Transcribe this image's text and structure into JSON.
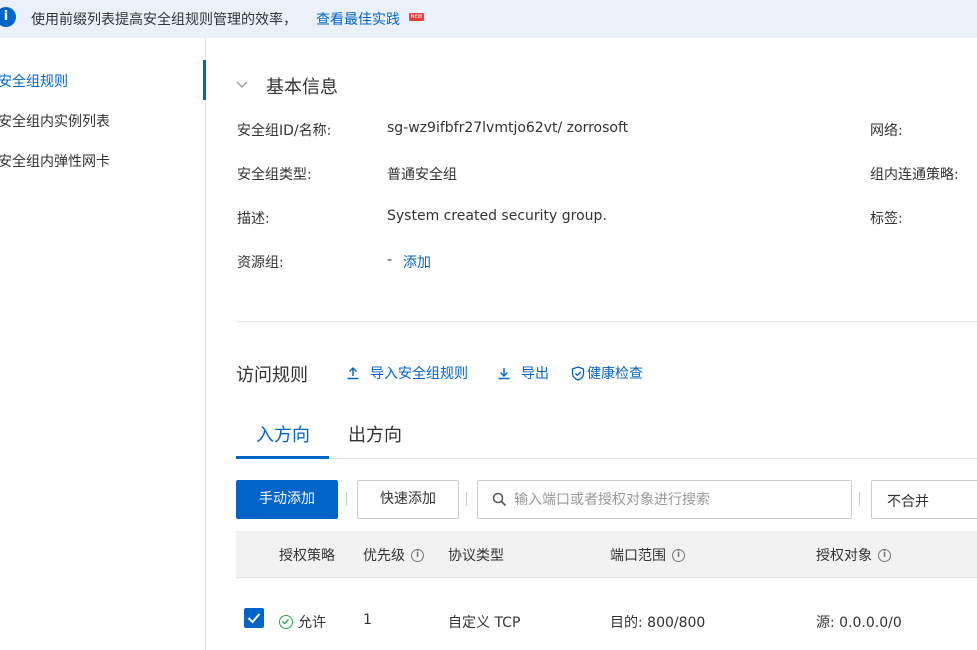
{
  "banner": {
    "text": "使用前缀列表提高安全组规则管理的效率，",
    "link": "查看最佳实践",
    "badge": "NEW"
  },
  "sidebar": {
    "items": [
      {
        "label": "安全组规则"
      },
      {
        "label": "安全组内实例列表"
      },
      {
        "label": "安全组内弹性网卡"
      }
    ]
  },
  "basic_info": {
    "title": "基本信息",
    "fields": [
      {
        "label": "安全组ID/名称:",
        "value": "sg-wz9ifbfr27lvmtjo62vt/ zorrosoft"
      },
      {
        "label": "安全组类型:",
        "value": "普通安全组"
      },
      {
        "label": "描述:",
        "value": "System created security group."
      },
      {
        "label": "资源组:",
        "value": "-",
        "link": "添加"
      }
    ],
    "right_labels": [
      "网络:",
      "组内连通策略:",
      "标签:"
    ]
  },
  "access_rules": {
    "title": "访问规则",
    "actions": [
      "导入安全组规则",
      "导出",
      "健康检查"
    ]
  },
  "tabs": [
    {
      "label": "入方向"
    },
    {
      "label": "出方向"
    }
  ],
  "toolbar": {
    "manual_add": "手动添加",
    "quick_add": "快速添加",
    "search_placeholder": "输入端口或者授权对象进行搜索",
    "merge_select": "不合并"
  },
  "table": {
    "columns": [
      "授权策略",
      "优先级",
      "协议类型",
      "端口范围",
      "授权对象"
    ],
    "rows": [
      {
        "policy": "允许",
        "priority": "1",
        "protocol": "自定义 TCP",
        "port": "目的: 800/800",
        "target": "源: 0.0.0.0/0"
      }
    ]
  },
  "colors": {
    "accent": "#0064c8",
    "banner_bg": "#ebf1fb",
    "allow": "#2aa14c"
  }
}
